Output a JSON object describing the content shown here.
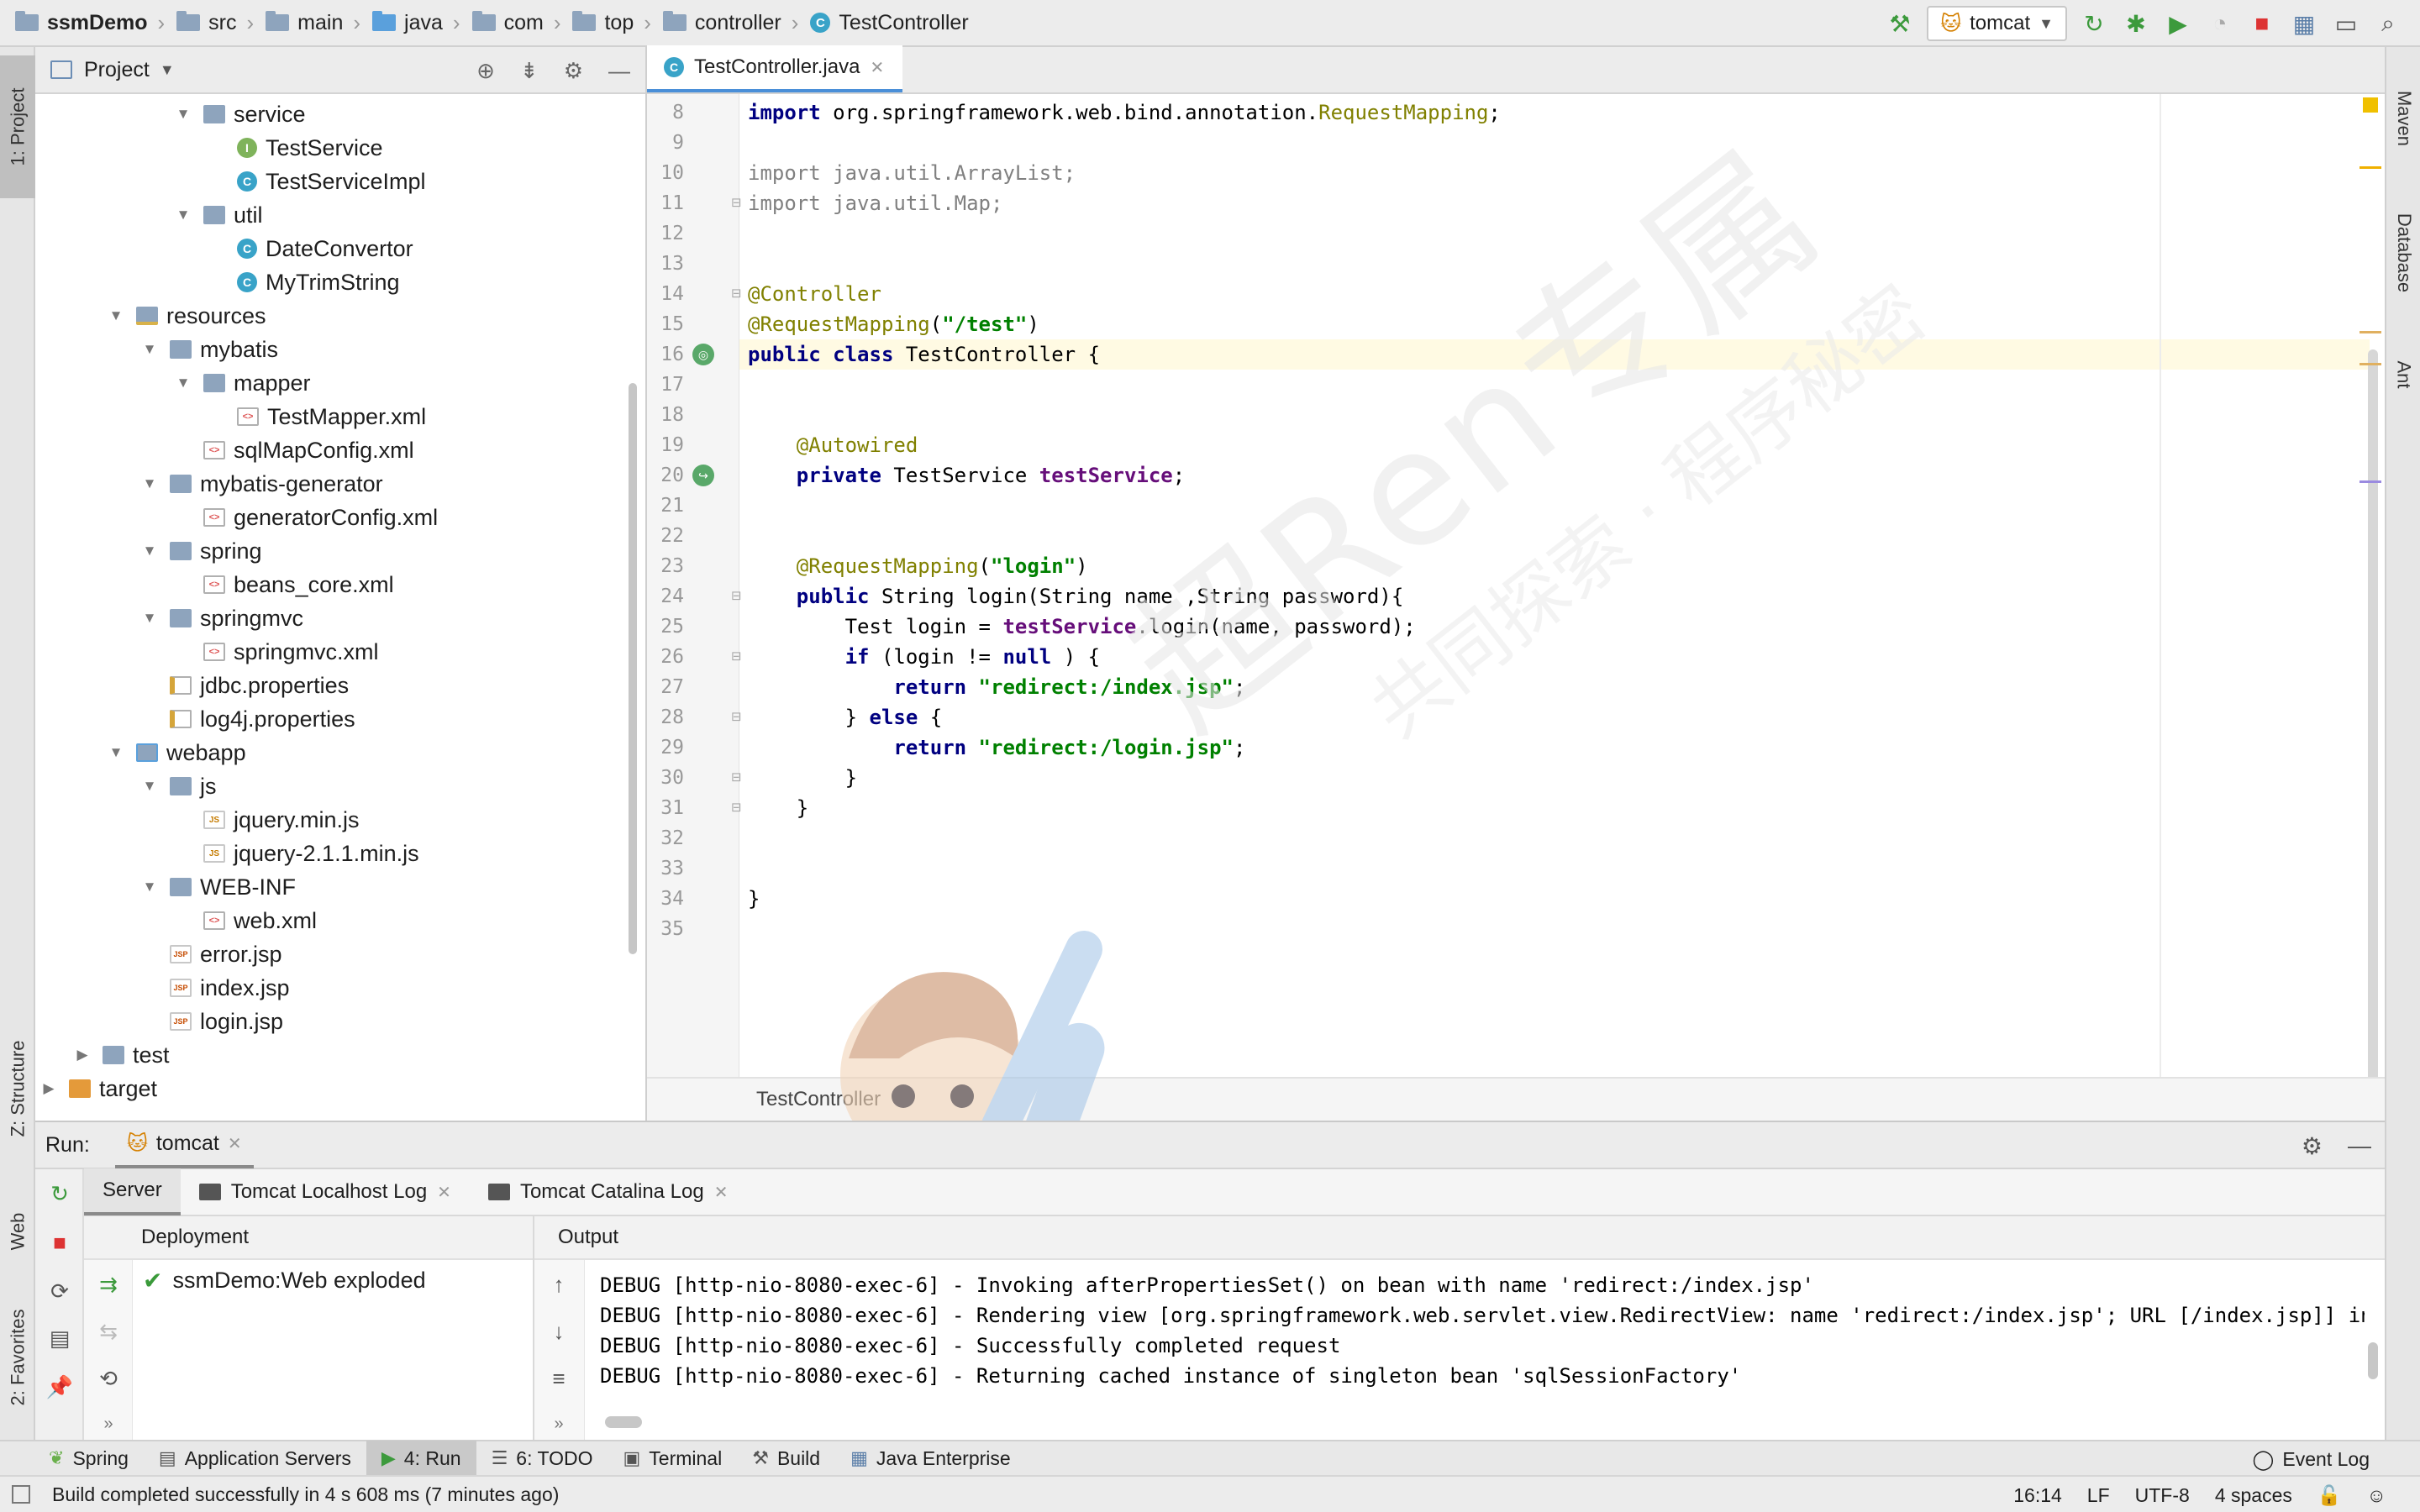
{
  "breadcrumbs": [
    "ssmDemo",
    "src",
    "main",
    "java",
    "com",
    "top",
    "controller",
    "TestController"
  ],
  "run_config": {
    "name": "tomcat"
  },
  "left_strip": {
    "project": "1: Project",
    "structure": "Z: Structure",
    "web": "Web",
    "favorites": "2: Favorites"
  },
  "right_strip": {
    "maven": "Maven",
    "database": "Database",
    "ant": "Ant"
  },
  "project_panel": {
    "title": "Project",
    "tree": [
      {
        "label": "service",
        "type": "folder",
        "depth": 5,
        "expanded": true
      },
      {
        "label": "TestService",
        "type": "interface",
        "depth": 6
      },
      {
        "label": "TestServiceImpl",
        "type": "class",
        "depth": 6
      },
      {
        "label": "util",
        "type": "folder",
        "depth": 5,
        "expanded": true
      },
      {
        "label": "DateConvertor",
        "type": "class",
        "depth": 6
      },
      {
        "label": "MyTrimString",
        "type": "class",
        "depth": 6
      },
      {
        "label": "resources",
        "type": "resources",
        "depth": 3,
        "expanded": true
      },
      {
        "label": "mybatis",
        "type": "folder",
        "depth": 4,
        "expanded": true
      },
      {
        "label": "mapper",
        "type": "folder",
        "depth": 5,
        "expanded": true
      },
      {
        "label": "TestMapper.xml",
        "type": "xml",
        "depth": 6
      },
      {
        "label": "sqlMapConfig.xml",
        "type": "xml",
        "depth": 5
      },
      {
        "label": "mybatis-generator",
        "type": "folder",
        "depth": 4,
        "expanded": true
      },
      {
        "label": "generatorConfig.xml",
        "type": "xml",
        "depth": 5
      },
      {
        "label": "spring",
        "type": "folder",
        "depth": 4,
        "expanded": true
      },
      {
        "label": "beans_core.xml",
        "type": "xml",
        "depth": 5
      },
      {
        "label": "springmvc",
        "type": "folder",
        "depth": 4,
        "expanded": true
      },
      {
        "label": "springmvc.xml",
        "type": "xml",
        "depth": 5
      },
      {
        "label": "jdbc.properties",
        "type": "props",
        "depth": 4
      },
      {
        "label": "log4j.properties",
        "type": "props",
        "depth": 4
      },
      {
        "label": "webapp",
        "type": "web",
        "depth": 3,
        "expanded": true
      },
      {
        "label": "js",
        "type": "folder",
        "depth": 4,
        "expanded": true
      },
      {
        "label": "jquery.min.js",
        "type": "js",
        "depth": 5
      },
      {
        "label": "jquery-2.1.1.min.js",
        "type": "js",
        "depth": 5
      },
      {
        "label": "WEB-INF",
        "type": "folder",
        "depth": 4,
        "expanded": true
      },
      {
        "label": "web.xml",
        "type": "xml",
        "depth": 5
      },
      {
        "label": "error.jsp",
        "type": "jsp",
        "depth": 4
      },
      {
        "label": "index.jsp",
        "type": "jsp",
        "depth": 4
      },
      {
        "label": "login.jsp",
        "type": "jsp",
        "depth": 4
      },
      {
        "label": "test",
        "type": "folder",
        "depth": 2,
        "expanded": false
      },
      {
        "label": "target",
        "type": "orange",
        "depth": 1,
        "expanded": false
      }
    ]
  },
  "editor": {
    "tab": "TestController.java",
    "breadcrumb": "TestController",
    "first_line": 8,
    "lines": [
      [
        [
          "kw",
          "import"
        ],
        [
          "",
          " org.springframework.web.bind.annotation."
        ],
        [
          "ann",
          "RequestMapping"
        ],
        [
          "",
          ";"
        ]
      ],
      [],
      [
        [
          "grey",
          "import java.util.ArrayList;"
        ]
      ],
      [
        [
          "grey",
          "import java.util.Map;"
        ]
      ],
      [],
      [],
      [
        [
          "ann",
          "@Controller"
        ]
      ],
      [
        [
          "ann",
          "@RequestMapping"
        ],
        [
          "",
          "("
        ],
        [
          "str",
          "\"/test\""
        ],
        [
          "",
          ")"
        ]
      ],
      [
        [
          "kw",
          "public class"
        ],
        [
          "",
          " TestController {"
        ]
      ],
      [],
      [],
      [
        [
          "",
          "    "
        ],
        [
          "ann",
          "@Autowired"
        ]
      ],
      [
        [
          "",
          "    "
        ],
        [
          "kw",
          "private"
        ],
        [
          "",
          " TestService "
        ],
        [
          "fld",
          "testService"
        ],
        [
          "",
          ";"
        ]
      ],
      [],
      [],
      [
        [
          "",
          "    "
        ],
        [
          "ann",
          "@RequestMapping"
        ],
        [
          "",
          "("
        ],
        [
          "str",
          "\"login\""
        ],
        [
          "",
          ")"
        ]
      ],
      [
        [
          "",
          "    "
        ],
        [
          "kw",
          "public"
        ],
        [
          "",
          " String login(String name ,String password){"
        ]
      ],
      [
        [
          "",
          "        Test login = "
        ],
        [
          "fld",
          "testService"
        ],
        [
          "",
          ".login(name, password);"
        ]
      ],
      [
        [
          "",
          "        "
        ],
        [
          "kw",
          "if"
        ],
        [
          "",
          " (login != "
        ],
        [
          "kw",
          "null"
        ],
        [
          "",
          " ) {"
        ]
      ],
      [
        [
          "",
          "            "
        ],
        [
          "kw",
          "return"
        ],
        [
          "",
          " "
        ],
        [
          "str",
          "\"redirect:/index.jsp\""
        ],
        [
          "",
          ";"
        ]
      ],
      [
        [
          "",
          "        } "
        ],
        [
          "kw",
          "else"
        ],
        [
          "",
          " {"
        ]
      ],
      [
        [
          "",
          "            "
        ],
        [
          "kw",
          "return"
        ],
        [
          "",
          " "
        ],
        [
          "str",
          "\"redirect:/login.jsp\""
        ],
        [
          "",
          ";"
        ]
      ],
      [
        [
          "",
          "        }"
        ]
      ],
      [
        [
          "",
          "    }"
        ]
      ],
      [],
      [],
      [
        [
          "",
          "}"
        ]
      ],
      []
    ]
  },
  "watermark": {
    "big": "超Ren专属",
    "small": "共同探索 · 程序秘密"
  },
  "run_panel": {
    "label": "Run:",
    "tab": "tomcat",
    "subtabs": [
      "Server",
      "Tomcat Localhost Log",
      "Tomcat Catalina Log"
    ],
    "deployment_header": "Deployment",
    "deployment_item": "ssmDemo:Web exploded",
    "output_header": "Output",
    "output_lines": [
      "DEBUG [http-nio-8080-exec-6] - Invoking afterPropertiesSet() on bean with name 'redirect:/index.jsp'",
      "DEBUG [http-nio-8080-exec-6] - Rendering view [org.springframework.web.servlet.view.RedirectView: name 'redirect:/index.jsp'; URL [/index.jsp]] in Dispat",
      "DEBUG [http-nio-8080-exec-6] - Successfully completed request",
      "DEBUG [http-nio-8080-exec-6] - Returning cached instance of singleton bean 'sqlSessionFactory'"
    ]
  },
  "bottom_tools": [
    "Spring",
    "Application Servers",
    "4: Run",
    "6: TODO",
    "Terminal",
    "Build",
    "Java Enterprise"
  ],
  "event_log": "Event Log",
  "status": {
    "message": "Build completed successfully in 4 s 608 ms (7 minutes ago)",
    "position": "16:14",
    "line_sep": "LF",
    "encoding": "UTF-8",
    "indent": "4 spaces"
  }
}
